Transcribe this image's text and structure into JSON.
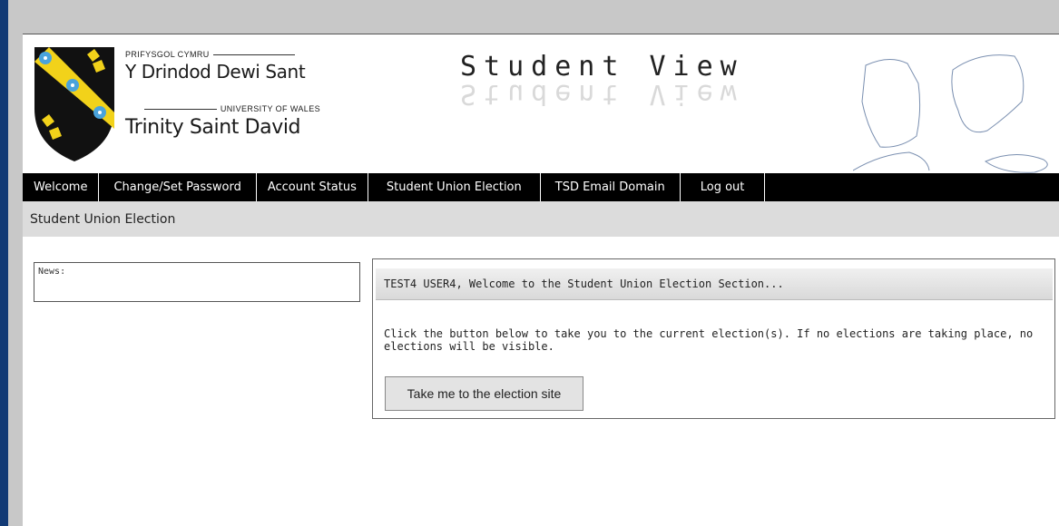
{
  "header": {
    "logo": {
      "line1": "PRIFYSGOL CYMRU",
      "name1": "Y Drindod Dewi Sant",
      "line2": "UNIVERSITY OF WALES",
      "name2": "Trinity Saint David"
    },
    "title": "Student View"
  },
  "nav": {
    "items": [
      {
        "label": "Welcome"
      },
      {
        "label": "Change/Set Password"
      },
      {
        "label": "Account Status"
      },
      {
        "label": "Student Union Election"
      },
      {
        "label": "TSD Email Domain"
      },
      {
        "label": "Log out"
      }
    ]
  },
  "breadcrumb": "Student Union Election",
  "news": {
    "label": "News:"
  },
  "election": {
    "heading": "TEST4 USER4, Welcome to the Student Union Election Section...",
    "description": "Click the button below to take you to the current election(s). If no elections are taking place, no elections will be visible.",
    "button_label": "Take me to the election site"
  },
  "colors": {
    "left_bar": "#123a75",
    "nav_bg": "#000000",
    "crumb_bg": "#dcdcdc",
    "shield_yellow": "#f2d21a",
    "shield_flower": "#4aa3dc"
  },
  "icons": [
    "university-shield-logo",
    "leaf-outline-decoration"
  ]
}
